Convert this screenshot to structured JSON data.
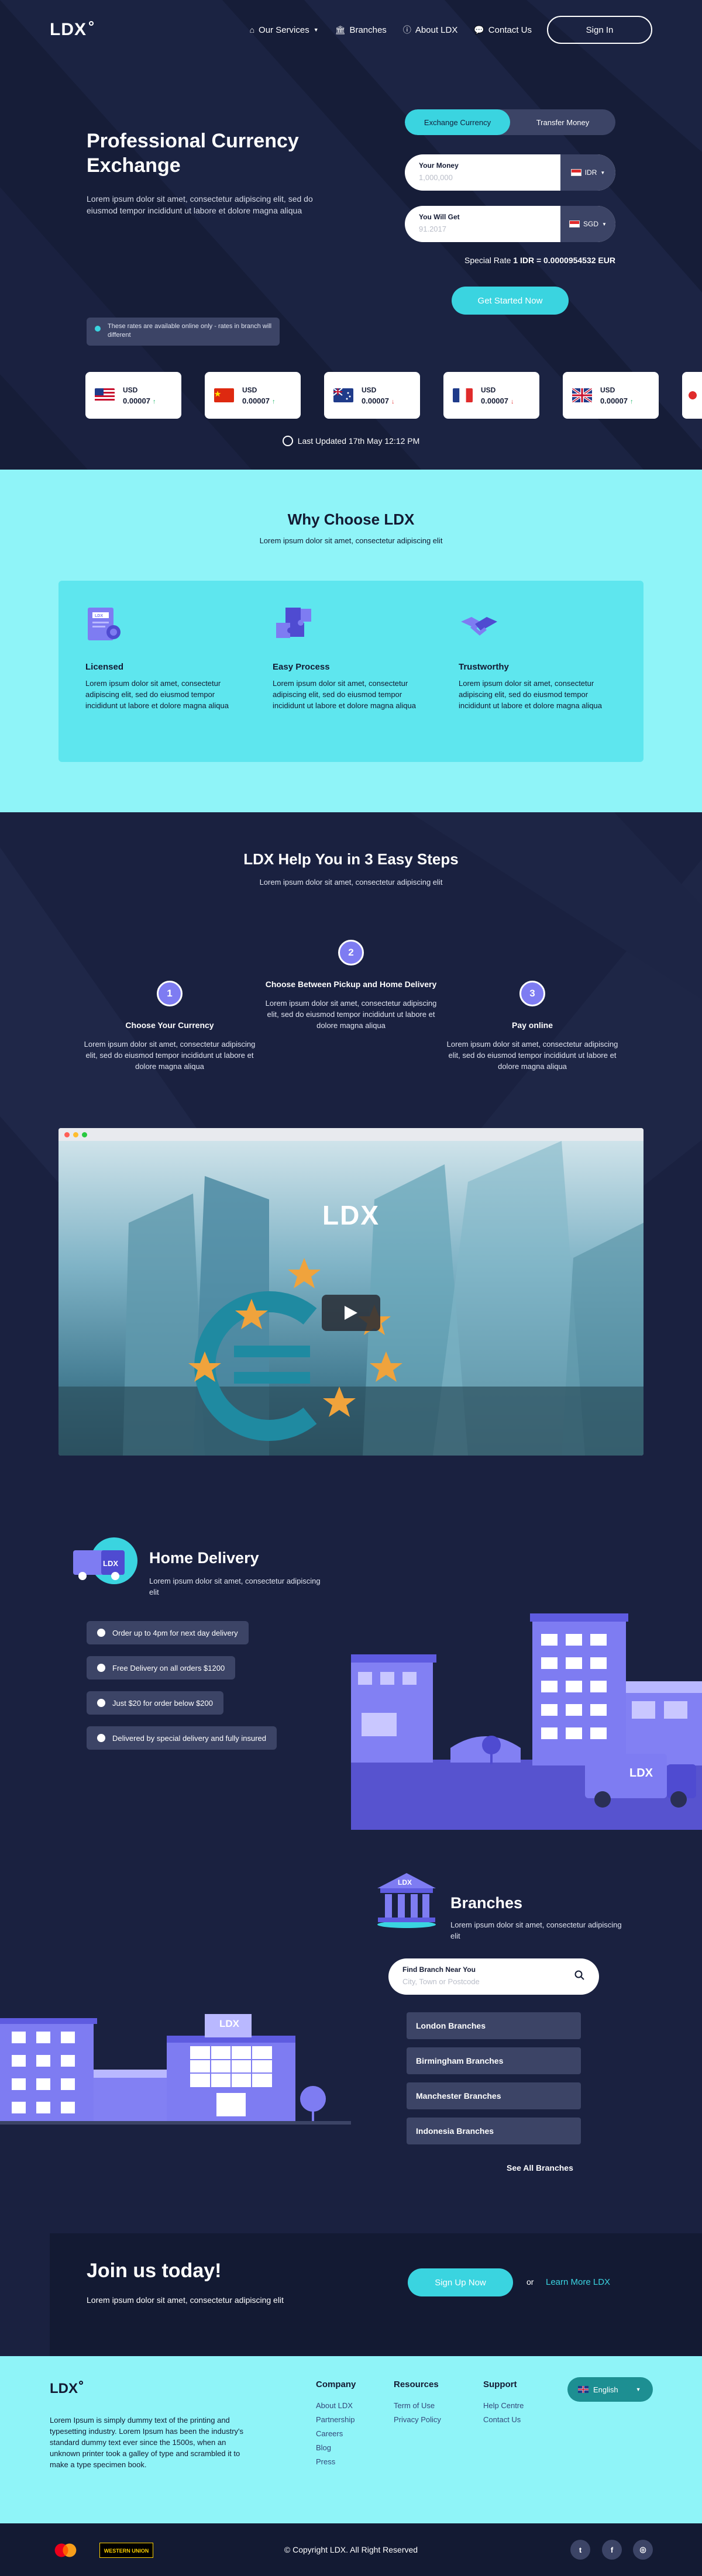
{
  "header": {
    "logo": "LDX",
    "nav": [
      {
        "label": "Our Services",
        "icon": "home-icon",
        "dropdown": true
      },
      {
        "label": "Branches",
        "icon": "bank-icon"
      },
      {
        "label": "About LDX",
        "icon": "info-icon"
      },
      {
        "label": "Contact Us",
        "icon": "chat-icon"
      }
    ],
    "signin_label": "Sign In"
  },
  "hero": {
    "title": "Professional Currency Exchange",
    "description": "Lorem ipsum dolor sit amet, consectetur adipiscing elit, sed do eiusmod tempor incididunt ut labore et dolore magna aliqua",
    "tabs": [
      "Exchange Currency",
      "Transfer Money"
    ],
    "active_tab": "Exchange Currency",
    "your_money": {
      "label": "Your Money",
      "placeholder": "1,000,000",
      "currency": "IDR"
    },
    "you_will_get": {
      "label": "You Will Get",
      "placeholder": "91.2017",
      "currency": "SGD"
    },
    "special_rate_label": "Special Rate",
    "special_rate_value": "1 IDR = 0.0000954532 EUR",
    "cta": "Get Started Now",
    "notice": "These rates are available online only - rates in branch will different",
    "rates": [
      {
        "currency": "USD",
        "value": "0.00007",
        "trend": "up",
        "flag": "us"
      },
      {
        "currency": "USD",
        "value": "0.00007",
        "trend": "up",
        "flag": "cn"
      },
      {
        "currency": "USD",
        "value": "0.00007",
        "trend": "down",
        "flag": "au"
      },
      {
        "currency": "USD",
        "value": "0.00007",
        "trend": "down",
        "flag": "fr"
      },
      {
        "currency": "USD",
        "value": "0.00007",
        "trend": "up",
        "flag": "uk"
      }
    ],
    "last_updated": "Last Updated 17th May 12:12 PM"
  },
  "why": {
    "title": "Why Choose LDX",
    "subtitle": "Lorem ipsum dolor sit amet, consectetur adipiscing elit",
    "features": [
      {
        "title": "Licensed",
        "text": "Lorem ipsum dolor sit amet, consectetur adipiscing elit, sed do eiusmod tempor incididunt ut labore et dolore magna aliqua",
        "icon": "certificate-icon"
      },
      {
        "title": "Easy Process",
        "text": "Lorem ipsum dolor sit amet, consectetur adipiscing elit, sed do eiusmod tempor incididunt ut labore et dolore magna aliqua",
        "icon": "puzzle-icon"
      },
      {
        "title": "Trustworthy",
        "text": "Lorem ipsum dolor sit amet, consectetur adipiscing elit, sed do eiusmod tempor incididunt ut labore et dolore magna aliqua",
        "icon": "handshake-icon"
      }
    ]
  },
  "steps": {
    "title": "LDX Help You in 3 Easy Steps",
    "subtitle": "Lorem ipsum dolor sit amet, consectetur adipiscing elit",
    "items": [
      {
        "num": "1",
        "title": "Choose Your Currency",
        "text": "Lorem ipsum dolor sit amet, consectetur adipiscing elit, sed do eiusmod tempor incididunt ut labore et dolore magna aliqua"
      },
      {
        "num": "2",
        "title": "Choose Between Pickup and Home Delivery",
        "text": "Lorem ipsum dolor sit amet, consectetur adipiscing elit, sed do eiusmod tempor incididunt ut labore et dolore magna aliqua"
      },
      {
        "num": "3",
        "title": "Pay online",
        "text": "Lorem ipsum dolor sit amet, consectetur adipiscing elit, sed do eiusmod tempor incididunt ut labore et dolore magna aliqua"
      }
    ],
    "video_logo": "LDX"
  },
  "delivery": {
    "title": "Home Delivery",
    "description": "Lorem ipsum dolor sit amet, consectetur adipiscing elit",
    "badge": "LDX",
    "points": [
      "Order up to 4pm for next day delivery",
      "Free Delivery on all orders $1200",
      "Just $20 for order below $200",
      "Delivered by special delivery and fully insured"
    ],
    "van_logo": "LDX"
  },
  "branches": {
    "title": "Branches",
    "description": "Lorem ipsum dolor sit amet, consectetur adipiscing elit",
    "badge": "LDX",
    "search_label": "Find Branch Near You",
    "search_placeholder": "City, Town or Postcode",
    "items": [
      "London Branches",
      "Birmingham Branches",
      "Manchester Branches",
      "Indonesia Branches"
    ],
    "see_all": "See All Branches",
    "building_sign": "LDX",
    "building_sign_small": "LDX"
  },
  "join": {
    "title": "Join us today!",
    "subtitle": "Lorem ipsum dolor sit amet, consectetur adipiscing elit",
    "signup": "Sign Up Now",
    "or": "or",
    "learn_more": "Learn More LDX"
  },
  "footer": {
    "logo": "LDX",
    "description": "Lorem Ipsum is simply dummy text of the printing and typesetting industry. Lorem Ipsum has been the industry's standard dummy text ever since the 1500s, when an unknown printer took a galley of type and scrambled it to make a type specimen book.",
    "columns": [
      {
        "title": "Company",
        "links": [
          "About LDX",
          "Partnership",
          "Careers",
          "Blog",
          "Press"
        ]
      },
      {
        "title": "Resources",
        "links": [
          "Term of Use",
          "Privacy Policy"
        ]
      },
      {
        "title": "Support",
        "links": [
          "Help Centre",
          "Contact Us"
        ]
      }
    ],
    "language": "English",
    "copyright": "© Copyright LDX. All Right Reserved",
    "payment": [
      "mastercard-logo",
      "western-union-logo"
    ],
    "western_union_text": "WESTERN UNION",
    "social": [
      {
        "name": "twitter-icon",
        "glyph": "t"
      },
      {
        "name": "facebook-icon",
        "glyph": "f"
      },
      {
        "name": "instagram-icon",
        "glyph": "◎"
      }
    ]
  },
  "colors": {
    "navy": "#161d38",
    "cyan": "#3ad4e0",
    "light_cyan": "#8ff4f8",
    "purple": "#7e7cf2",
    "slate": "#3c4466"
  }
}
